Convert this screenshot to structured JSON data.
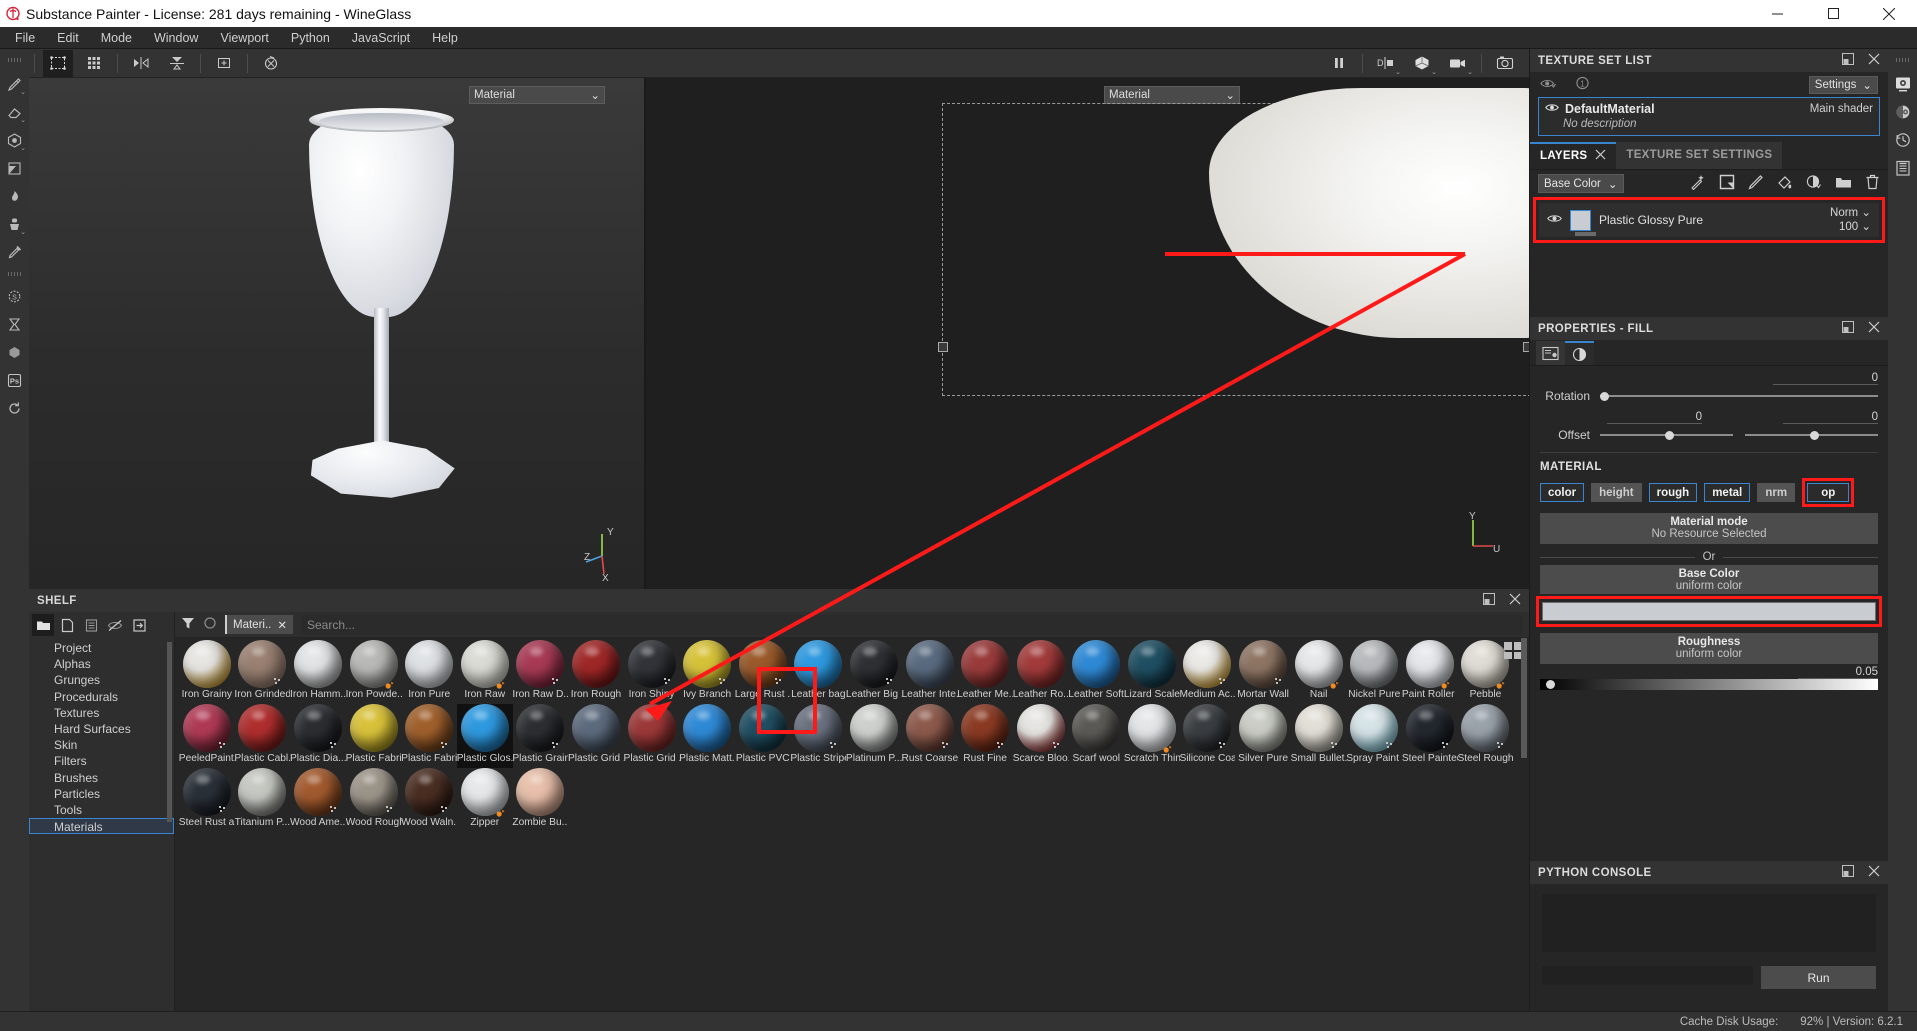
{
  "window": {
    "title": "Substance Painter - License: 281 days remaining - WineGlass",
    "logo_icon": "substance-logo-icon",
    "minimize": "–",
    "maximize": "▢",
    "close": "✕"
  },
  "menubar": {
    "items": [
      "File",
      "Edit",
      "Mode",
      "Window",
      "Viewport",
      "Python",
      "JavaScript",
      "Help"
    ]
  },
  "left_toolbar": {
    "items": [
      {
        "name": "paint-brush-tool",
        "glyph": "✎"
      },
      {
        "name": "eraser-tool",
        "glyph": "▱"
      },
      {
        "name": "projection-tool",
        "glyph": "⬡"
      },
      {
        "name": "polygon-fill-tool",
        "glyph": "◺"
      },
      {
        "name": "smudge-tool",
        "glyph": "☂"
      },
      {
        "name": "clone-tool",
        "glyph": "♙"
      },
      {
        "name": "material-picker-tool",
        "glyph": "⌁"
      },
      {
        "name": "substance-engine-icon",
        "glyph": "❂"
      },
      {
        "name": "baking-hourglass-icon",
        "glyph": "⧖"
      },
      {
        "name": "substance-source-icon",
        "glyph": "⬢"
      },
      {
        "name": "photoshop-link-icon",
        "glyph": "Ps"
      },
      {
        "name": "refresh-icon",
        "glyph": "◯"
      }
    ]
  },
  "top_toolbar": {
    "left_items": [
      {
        "name": "selection-mode-icon",
        "glyph": "⬚"
      },
      {
        "name": "uv-grid-icon",
        "glyph": "▦"
      },
      {
        "name": "symmetry-icon",
        "glyph": "▶◀"
      },
      {
        "name": "mirror-plane-icon",
        "glyph": "▼"
      },
      {
        "name": "add-pivot-icon",
        "glyph": "✛"
      },
      {
        "name": "reset-rotation-icon",
        "glyph": "⊗"
      }
    ],
    "right_items": [
      {
        "name": "pause-engine-icon",
        "glyph": "❚❚"
      },
      {
        "name": "display-channels-icon",
        "glyph": "D|o"
      },
      {
        "name": "shading-mode-icon",
        "glyph": "⬢"
      },
      {
        "name": "camera-mode-icon",
        "glyph": "▣"
      },
      {
        "name": "screenshot-icon",
        "glyph": "⎙"
      }
    ]
  },
  "viewport_3d": {
    "material_dropdown": "Material",
    "axis_labels": [
      "Y",
      "Z",
      "X"
    ]
  },
  "viewport_2d": {
    "material_dropdown": "Material",
    "axis_labels": [
      "Y",
      "U"
    ]
  },
  "texture_set_list": {
    "title": "TEXTURE SET LIST",
    "settings_button": "Settings",
    "material_name": "DefaultMaterial",
    "material_description": "No description",
    "shader_label": "Main shader",
    "toolbar_icons": [
      {
        "name": "visibility-toggle-icon",
        "glyph": "👁"
      },
      {
        "name": "single-view-icon",
        "glyph": "①"
      }
    ]
  },
  "layers_panel": {
    "tabs": [
      {
        "label": "LAYERS",
        "selected": true
      },
      {
        "label": "TEXTURE SET SETTINGS",
        "selected": false
      }
    ],
    "channel_selector": "Base Color",
    "toolbar_icons": [
      {
        "name": "add-effect-icon",
        "glyph": "✨"
      },
      {
        "name": "add-fill-layer-icon",
        "glyph": "◳"
      },
      {
        "name": "add-paint-layer-icon",
        "glyph": "✎"
      },
      {
        "name": "add-fill-icon",
        "glyph": "⬧"
      },
      {
        "name": "add-smart-mask-icon",
        "glyph": "◐"
      },
      {
        "name": "add-folder-icon",
        "glyph": "📁"
      },
      {
        "name": "delete-layer-icon",
        "glyph": "🗑"
      }
    ],
    "layers": [
      {
        "name": "Plastic Glossy Pure",
        "blend_mode": "Norm",
        "opacity": "100",
        "visible": true,
        "highlighted": true
      }
    ]
  },
  "properties_panel": {
    "title": "PROPERTIES - FILL",
    "tabs": [
      {
        "name": "properties-tab",
        "glyph": "▤",
        "selected": false
      },
      {
        "name": "material-tab",
        "glyph": "◐",
        "selected": true
      }
    ],
    "rotation": {
      "label": "Rotation",
      "value": "0"
    },
    "offset": {
      "label": "Offset",
      "value_u": "0",
      "value_v": "0"
    },
    "material_section_title": "MATERIAL",
    "channels": [
      {
        "label": "color",
        "enabled": true,
        "highlighted": false
      },
      {
        "label": "height",
        "enabled": false,
        "highlighted": false
      },
      {
        "label": "rough",
        "enabled": true,
        "highlighted": false
      },
      {
        "label": "metal",
        "enabled": true,
        "highlighted": false
      },
      {
        "label": "nrm",
        "enabled": false,
        "highlighted": false
      },
      {
        "label": "op",
        "enabled": true,
        "highlighted": true
      }
    ],
    "material_mode": {
      "title": "Material mode",
      "subtitle": "No Resource Selected"
    },
    "or_label": "Or",
    "base_color": {
      "title": "Base Color",
      "subtitle": "uniform color",
      "swatch_hex": "#c9ccd1"
    },
    "roughness": {
      "title": "Roughness",
      "subtitle": "uniform color",
      "value": "0.05"
    }
  },
  "python_console": {
    "title": "PYTHON CONSOLE",
    "run_button": "Run",
    "input_value": "",
    "output_value": ""
  },
  "right_rail": {
    "items": [
      {
        "name": "display-settings-icon",
        "glyph": "⚙"
      },
      {
        "name": "shader-settings-icon",
        "glyph": "◕"
      },
      {
        "name": "history-icon",
        "glyph": "🕐"
      },
      {
        "name": "log-icon",
        "glyph": "▤"
      }
    ]
  },
  "shelf": {
    "title": "SHELF",
    "tools": [
      {
        "name": "library-folder-icon",
        "glyph": "▰",
        "selected": true
      },
      {
        "name": "new-resource-icon",
        "glyph": "◳"
      },
      {
        "name": "save-resource-icon",
        "glyph": "▤"
      },
      {
        "name": "hide-resource-icon",
        "glyph": "◌"
      },
      {
        "name": "import-resource-icon",
        "glyph": "⇥"
      }
    ],
    "filter_icon": "filter-funnel-icon",
    "reset_icon": "reset-circle-icon",
    "active_chip": "Materi..",
    "search_placeholder": "Search...",
    "categories": [
      {
        "label": "Project",
        "selected": false
      },
      {
        "label": "Alphas",
        "selected": false
      },
      {
        "label": "Grunges",
        "selected": false
      },
      {
        "label": "Procedurals",
        "selected": false
      },
      {
        "label": "Textures",
        "selected": false
      },
      {
        "label": "Hard Surfaces",
        "selected": false
      },
      {
        "label": "Skin",
        "selected": false
      },
      {
        "label": "Filters",
        "selected": false
      },
      {
        "label": "Brushes",
        "selected": false
      },
      {
        "label": "Particles",
        "selected": false
      },
      {
        "label": "Tools",
        "selected": false
      },
      {
        "label": "Materials",
        "selected": true
      }
    ],
    "materials": [
      {
        "label": "Iron Grainy",
        "color": "#e8e6e2",
        "accent": "#d9a020",
        "badge": "none"
      },
      {
        "label": "Iron Grinded",
        "color": "#9a8172",
        "accent": "",
        "badge": "dots"
      },
      {
        "label": "Iron Hamm...",
        "color": "#e2e4e6",
        "accent": "#a8a8a8",
        "badge": "none"
      },
      {
        "label": "Iron Powde...",
        "color": "#b9b9b7",
        "accent": "#8d8d8a",
        "badge": "orange"
      },
      {
        "label": "Iron Pure",
        "color": "#dfe2e5",
        "accent": "#c2c6ca",
        "badge": "none"
      },
      {
        "label": "Iron Raw",
        "color": "#dcdcd6",
        "accent": "#cfcfc6",
        "badge": "orange"
      },
      {
        "label": "Iron Raw D...",
        "color": "#a83a55",
        "accent": "#7a2238",
        "badge": "dots"
      },
      {
        "label": "Iron Rough",
        "color": "#9f2727",
        "accent": "#6d1515",
        "badge": "none"
      },
      {
        "label": "Iron Shiny",
        "color": "#32343a",
        "accent": "#1b1c20",
        "badge": "dots"
      },
      {
        "label": "Ivy Branch",
        "color": "#d7c339",
        "accent": "#a89722",
        "badge": "dots"
      },
      {
        "label": "Large Rust ...",
        "color": "#9a5a2a",
        "accent": "#6d3b18",
        "badge": "dots"
      },
      {
        "label": "Leather bag",
        "color": "#2e9ae0",
        "accent": "#1b6fa8",
        "badge": "none"
      },
      {
        "label": "Leather Big ...",
        "color": "#2e3034",
        "accent": "#17181b",
        "badge": "dots"
      },
      {
        "label": "Leather Inte...",
        "color": "#5a6b80",
        "accent": "#3b4757",
        "badge": "none"
      },
      {
        "label": "Leather Me...",
        "color": "#9b3b3b",
        "accent": "#6d2424",
        "badge": "none"
      },
      {
        "label": "Leather Ro...",
        "color": "#a33b3b",
        "accent": "#742424",
        "badge": "none"
      },
      {
        "label": "Leather Soft...",
        "color": "#2f8ad6",
        "accent": "#1d5f98",
        "badge": "none"
      },
      {
        "label": "Lizard Scales",
        "color": "#1f4f63",
        "accent": "#11303d",
        "badge": "none"
      },
      {
        "label": "Medium Ac...",
        "color": "#eceae6",
        "accent": "#d9a020",
        "badge": "dots"
      },
      {
        "label": "Mortar Wall",
        "color": "#8e7564",
        "accent": "#5f4b3c",
        "badge": "dots"
      },
      {
        "label": "Nail",
        "color": "#e6e8ea",
        "accent": "#b6b9bd",
        "badge": "orange"
      },
      {
        "label": "Nickel Pure",
        "color": "#b8bbbd",
        "accent": "#6f7478",
        "badge": "none"
      },
      {
        "label": "Paint Roller ...",
        "color": "#e5e7ea",
        "accent": "#c3c6ca",
        "badge": "orange"
      },
      {
        "label": "Pebble",
        "color": "#e0ddd5",
        "accent": "#bdb8ac",
        "badge": "orange"
      },
      {
        "label": "PeeledPaint...",
        "color": "#b03a55",
        "accent": "#6d2030",
        "badge": "dots"
      },
      {
        "label": "Plastic Cabl...",
        "color": "#b02e2e",
        "accent": "#701919",
        "badge": "none"
      },
      {
        "label": "Plastic Dia...",
        "color": "#2b2d31",
        "accent": "#151619",
        "badge": "dots"
      },
      {
        "label": "Plastic Fabri...",
        "color": "#d9c23a",
        "accent": "#a08c1c",
        "badge": "none"
      },
      {
        "label": "Plastic Fabri...",
        "color": "#a0602c",
        "accent": "#6c3e17",
        "badge": "dots"
      },
      {
        "label": "Plastic Glos...",
        "color": "#2e9ae0",
        "accent": "#1b6fa8",
        "badge": "none",
        "selected": true
      },
      {
        "label": "Plastic Grainy",
        "color": "#2c2e32",
        "accent": "#16171a",
        "badge": "dots"
      },
      {
        "label": "Plastic Grid ...",
        "color": "#5d6b7e",
        "accent": "#3c4654",
        "badge": "none"
      },
      {
        "label": "Plastic Grid ...",
        "color": "#9c3838",
        "accent": "#6a2222",
        "badge": "none"
      },
      {
        "label": "Plastic Matt...",
        "color": "#2f8ad6",
        "accent": "#1d5f98",
        "badge": "none"
      },
      {
        "label": "Plastic PVC",
        "color": "#1f4f63",
        "accent": "#11303d",
        "badge": "none"
      },
      {
        "label": "Plastic Stripes",
        "color": "#6a7180",
        "accent": "#454b57",
        "badge": "dots"
      },
      {
        "label": "Platinum P...",
        "color": "#cfd1cf",
        "accent": "#7e8280",
        "badge": "none"
      },
      {
        "label": "Rust Coarse",
        "color": "#8d5a4c",
        "accent": "#5c372d",
        "badge": "dots"
      },
      {
        "label": "Rust Fine",
        "color": "#8b3a23",
        "accent": "#5a2211",
        "badge": "dots"
      },
      {
        "label": "Scarce Bloo...",
        "color": "#e6e5e2",
        "accent": "#8a1a1a",
        "badge": "dots"
      },
      {
        "label": "Scarf wool",
        "color": "#5c5a56",
        "accent": "#3a3936",
        "badge": "none"
      },
      {
        "label": "Scratch Thin",
        "color": "#e4e6e8",
        "accent": "#c2c6ca",
        "badge": "orange"
      },
      {
        "label": "Silicone Coat",
        "color": "#3a3e42",
        "accent": "#202326",
        "badge": "dots"
      },
      {
        "label": "Silver Pure",
        "color": "#cbcdc6",
        "accent": "#86887f",
        "badge": "none"
      },
      {
        "label": "Small Bullet...",
        "color": "#e3e0d8",
        "accent": "#a6a296",
        "badge": "dots"
      },
      {
        "label": "Spray Paint ...",
        "color": "#d6e4e8",
        "accent": "#7cc4d6",
        "badge": "dots"
      },
      {
        "label": "Steel Painted",
        "color": "#23282f",
        "accent": "#10131a",
        "badge": "dots"
      },
      {
        "label": "Steel Rough",
        "color": "#9aa2aa",
        "accent": "#5d6670",
        "badge": "dots"
      },
      {
        "label": "Steel Rust a...",
        "color": "#2a3038",
        "accent": "#14181f",
        "badge": "dots"
      },
      {
        "label": "Titanium P...",
        "color": "#c6c8c2",
        "accent": "#7c7e79",
        "badge": "none"
      },
      {
        "label": "Wood Ame...",
        "color": "#a25a2e",
        "accent": "#6b3718",
        "badge": "dots"
      },
      {
        "label": "Wood Rough",
        "color": "#9c958a",
        "accent": "#645e55",
        "badge": "dots"
      },
      {
        "label": "Wood Waln...",
        "color": "#4a2e22",
        "accent": "#2a1810",
        "badge": "dots"
      },
      {
        "label": "Zipper",
        "color": "#e6e8ea",
        "accent": "#c0c4c8",
        "badge": "orange"
      },
      {
        "label": "Zombie Bu...",
        "color": "#e8c0ab",
        "accent": "#c29480",
        "badge": "none"
      }
    ]
  },
  "statusbar": {
    "cache_label": "Cache Disk Usage:",
    "cache_value": "92% | Version: 6.2.1"
  },
  "annotation": {
    "highlight_color": "#ff1a1a"
  }
}
